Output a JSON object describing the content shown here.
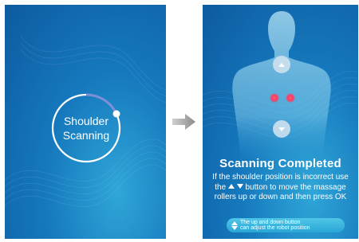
{
  "left_screen": {
    "ring_line1": "Shoulder",
    "ring_line2": "Scanning"
  },
  "right_screen": {
    "title": "Scanning Completed",
    "desc_part1": "If the shoulder position is incorrect use the",
    "desc_part2": "button to move the massage rollers up or down and then press OK",
    "hint_line1": "The up and down button",
    "hint_line2": "can adjust the robot position"
  },
  "icons": {
    "transition": "arrow-right-icon",
    "up": "triangle-up-icon",
    "down": "triangle-down-icon"
  },
  "colors": {
    "screen_blue": "#1679bd",
    "screen_light": "#2fa6d8",
    "hint_pill": "#3bb6e0",
    "glow_red": "#ff3a5e"
  }
}
